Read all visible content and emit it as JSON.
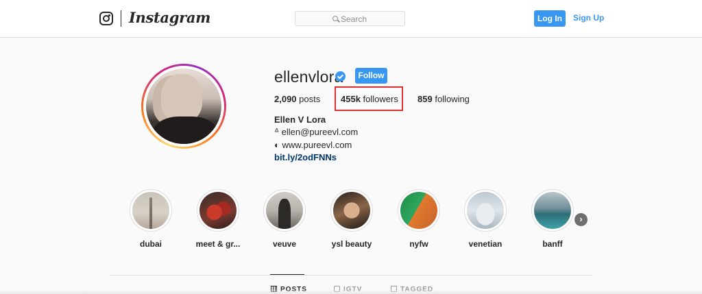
{
  "header": {
    "logo_text": "Instagram",
    "search_placeholder": "Search",
    "login_label": "Log In",
    "signup_label": "Sign Up"
  },
  "profile": {
    "username": "ellenvlora",
    "follow_label": "Follow",
    "posts_count": "2,090",
    "posts_label": "posts",
    "followers_count": "455k",
    "followers_label": "followers",
    "following_count": "859",
    "following_label": "following",
    "full_name": "Ellen V Lora",
    "bio_email": "ᐞ ellen@pureevl.com",
    "bio_website": "◐ www.pureevl.com",
    "bio_link": "bit.ly/2odFNNs"
  },
  "highlights": [
    {
      "label": "dubai"
    },
    {
      "label": "meet & gr..."
    },
    {
      "label": "veuve"
    },
    {
      "label": "ysl beauty"
    },
    {
      "label": "nyfw"
    },
    {
      "label": "venetian"
    },
    {
      "label": "banff"
    }
  ],
  "tabs": [
    {
      "label": "POSTS",
      "active": true
    },
    {
      "label": "IGTV",
      "active": false
    },
    {
      "label": "TAGGED",
      "active": false
    }
  ],
  "colors": {
    "accent": "#3897f0",
    "highlight_box": "#e0302e",
    "link": "#003569"
  }
}
